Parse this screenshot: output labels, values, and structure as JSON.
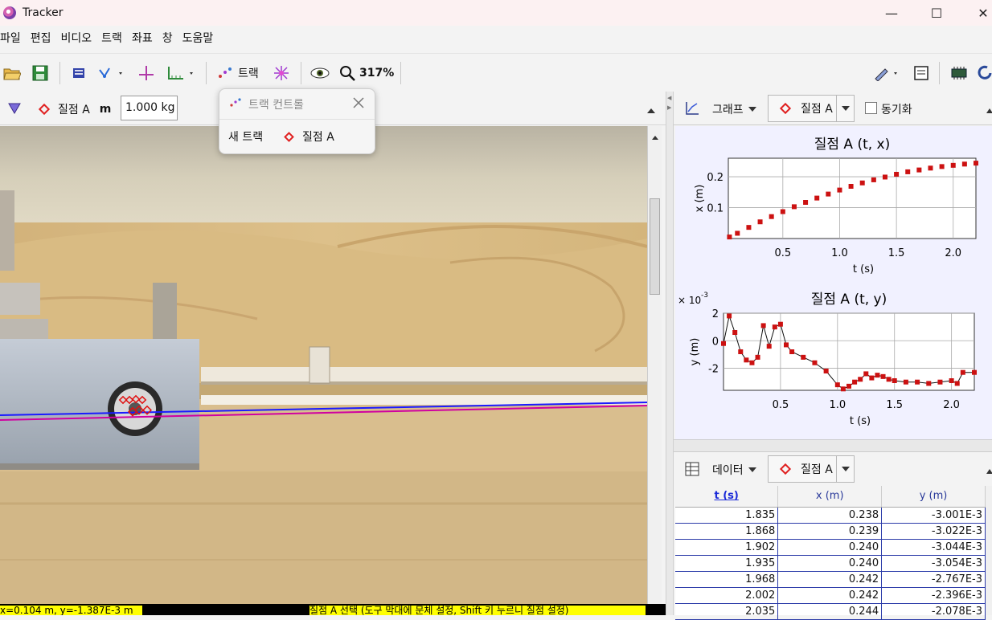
{
  "window": {
    "title": "Tracker",
    "min": "—",
    "max": "☐",
    "close": "✕"
  },
  "menu": [
    "파일",
    "편집",
    "비디오",
    "트랙",
    "좌표",
    "창",
    "도움말"
  ],
  "toolbar": {
    "track_label": "트랙",
    "zoom": "317%"
  },
  "trackbar": {
    "track_name": "질점 A",
    "mass_label": "m",
    "mass_value": "1.000 kg"
  },
  "popup": {
    "title": "트랙 컨트롤",
    "new_track": "새 트랙",
    "track_name": "질점 A"
  },
  "status": {
    "left": "x=0.104 m, y=-1.387E-3 m",
    "right": "질점 A 선택 (도구 막대에 문체 설정, Shift 키 누르니 질점 설정)"
  },
  "graph_panel": {
    "label": "그래프",
    "track": "질점 A",
    "sync_label": "동기화",
    "sync_checked": false
  },
  "data_panel": {
    "label": "데이터",
    "track": "질점 A"
  },
  "colors": {
    "accent": "#e02020",
    "axis_line": "#0000ff",
    "trail_line": "#d00099",
    "graph_bg": "#f1f1ff",
    "highlight": "#ffff00"
  },
  "chart_data": [
    {
      "type": "scatter",
      "title": "질점 A (t, x)",
      "xlabel": "t (s)",
      "ylabel": "x (m)",
      "xlim": [
        0.02,
        2.2
      ],
      "ylim": [
        0.0,
        0.26
      ],
      "xticks": [
        "0.5",
        "1.0",
        "1.5",
        "2.0"
      ],
      "yticks": [
        "0.1",
        "0.2"
      ],
      "grid": true,
      "series": [
        {
          "x": [
            0.03,
            0.1,
            0.2,
            0.3,
            0.4,
            0.5,
            0.6,
            0.7,
            0.8,
            0.9,
            1.0,
            1.1,
            1.2,
            1.3,
            1.4,
            1.5,
            1.6,
            1.7,
            1.8,
            1.9,
            2.0,
            2.1,
            2.2
          ],
          "y": [
            0.005,
            0.017,
            0.036,
            0.054,
            0.071,
            0.087,
            0.103,
            0.117,
            0.131,
            0.144,
            0.157,
            0.169,
            0.18,
            0.19,
            0.199,
            0.208,
            0.216,
            0.222,
            0.228,
            0.233,
            0.237,
            0.241,
            0.244
          ]
        }
      ]
    },
    {
      "type": "line",
      "title": "질점 A (t, y)",
      "xlabel": "t (s)",
      "ylabel": "y (m)",
      "scale_label": "× 10",
      "scale_exp": "-3",
      "xlim": [
        0.0,
        2.2
      ],
      "ylim": [
        -3.6,
        2.0
      ],
      "xticks": [
        "0.5",
        "1.0",
        "1.5",
        "2.0"
      ],
      "yticks": [
        "2",
        "0",
        "-2"
      ],
      "grid": true,
      "series": [
        {
          "x": [
            0.0,
            0.05,
            0.1,
            0.15,
            0.2,
            0.25,
            0.3,
            0.35,
            0.4,
            0.45,
            0.5,
            0.55,
            0.6,
            0.7,
            0.8,
            0.9,
            1.0,
            1.05,
            1.1,
            1.15,
            1.2,
            1.25,
            1.3,
            1.35,
            1.4,
            1.45,
            1.5,
            1.6,
            1.7,
            1.8,
            1.9,
            2.0,
            2.05,
            2.1,
            2.2
          ],
          "y": [
            -0.2,
            1.8,
            0.6,
            -0.8,
            -1.4,
            -1.6,
            -1.2,
            1.1,
            -0.4,
            1.0,
            1.2,
            -0.3,
            -0.8,
            -1.2,
            -1.6,
            -2.2,
            -3.2,
            -3.5,
            -3.3,
            -3.0,
            -2.8,
            -2.4,
            -2.7,
            -2.5,
            -2.6,
            -2.8,
            -2.9,
            -3.0,
            -3.0,
            -3.1,
            -3.0,
            -2.9,
            -3.1,
            -2.3,
            -2.3
          ]
        }
      ]
    }
  ],
  "data_table": {
    "columns": [
      "t (s)",
      "x (m)",
      "y (m)"
    ],
    "rows": [
      [
        "1.835",
        "0.238",
        "-3.001E-3"
      ],
      [
        "1.868",
        "0.239",
        "-3.022E-3"
      ],
      [
        "1.902",
        "0.240",
        "-3.044E-3"
      ],
      [
        "1.935",
        "0.240",
        "-3.054E-3"
      ],
      [
        "1.968",
        "0.242",
        "-2.767E-3"
      ],
      [
        "2.002",
        "0.242",
        "-2.396E-3"
      ],
      [
        "2.035",
        "0.244",
        "-2.078E-3"
      ]
    ]
  }
}
